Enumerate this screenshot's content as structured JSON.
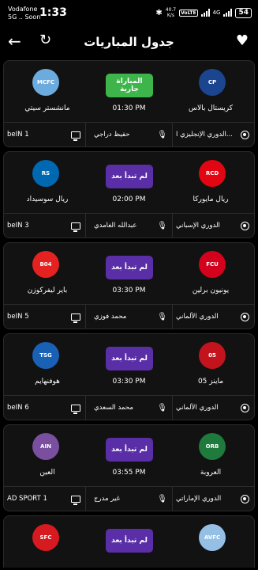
{
  "status_bar": {
    "carrier_line1": "Vodafone",
    "carrier_line2": "5G .. Soon",
    "time": "1:33",
    "net_speed_value": "40.7",
    "net_speed_unit": "K/s",
    "volte": "VoLTE",
    "network": "4G",
    "battery": "54"
  },
  "app_bar": {
    "title": "جدول المباريات",
    "back_icon": "arrow-back-icon",
    "refresh_icon": "refresh-icon",
    "favorite_icon": "heart-icon"
  },
  "matches": [
    {
      "home_team": "كريستال بالاس",
      "away_team": "مانشستر سيتي",
      "status": "المباراة جارية",
      "status_type": "live",
      "time": "01:30 PM",
      "league": "الدوري الإنجليزي ا...",
      "commentator": "حفيظ دراجي",
      "channel": "beIN 1",
      "home_logo_text": "CP",
      "away_logo_text": "MCFC",
      "home_color": "#1b458f",
      "away_color": "#6cabdd"
    },
    {
      "home_team": "ريال مايوركا",
      "away_team": "ريال سوسيداد",
      "status": "لم تبدأ بعد",
      "status_type": "upcoming",
      "time": "02:00 PM",
      "league": "الدوري الإسباني",
      "commentator": "عبدالله الغامدي",
      "channel": "beIN 3",
      "home_logo_text": "RCD",
      "away_logo_text": "RS",
      "home_color": "#e20613",
      "away_color": "#0067b1"
    },
    {
      "home_team": "يونيون برلين",
      "away_team": "باير ليفركوزن",
      "status": "لم تبدأ بعد",
      "status_type": "upcoming",
      "time": "03:30 PM",
      "league": "الدوري الألماني",
      "commentator": "محمد فوزي",
      "channel": "beIN 5",
      "home_logo_text": "FCU",
      "away_logo_text": "B04",
      "home_color": "#d4011d",
      "away_color": "#e32221"
    },
    {
      "home_team": "ماينز 05",
      "away_team": "هوفنهايم",
      "status": "لم تبدأ بعد",
      "status_type": "upcoming",
      "time": "03:30 PM",
      "league": "الدوري الألماني",
      "commentator": "محمد السعدي",
      "channel": "beIN 6",
      "home_logo_text": "05",
      "away_logo_text": "TSG",
      "home_color": "#c3141e",
      "away_color": "#1961b5"
    },
    {
      "home_team": "العروبة",
      "away_team": "العين",
      "status": "لم تبدأ بعد",
      "status_type": "upcoming",
      "time": "03:55 PM",
      "league": "الدوري الإماراتي",
      "commentator": "غير مدرج",
      "channel": "AD SPORT 1",
      "home_logo_text": "ORB",
      "away_logo_text": "AIN",
      "home_color": "#1f7a3d",
      "away_color": "#7b4fa0"
    },
    {
      "home_team": "",
      "away_team": "",
      "status": "لم تبدأ بعد",
      "status_type": "upcoming",
      "time": "",
      "league": "",
      "commentator": "",
      "channel": "",
      "home_logo_text": "AVFC",
      "away_logo_text": "SFC",
      "home_color": "#95bfe5",
      "away_color": "#d71920"
    }
  ],
  "colors": {
    "background": "#000000",
    "card": "#121212",
    "live": "#3db54a",
    "upcoming": "#5a2ea6"
  }
}
